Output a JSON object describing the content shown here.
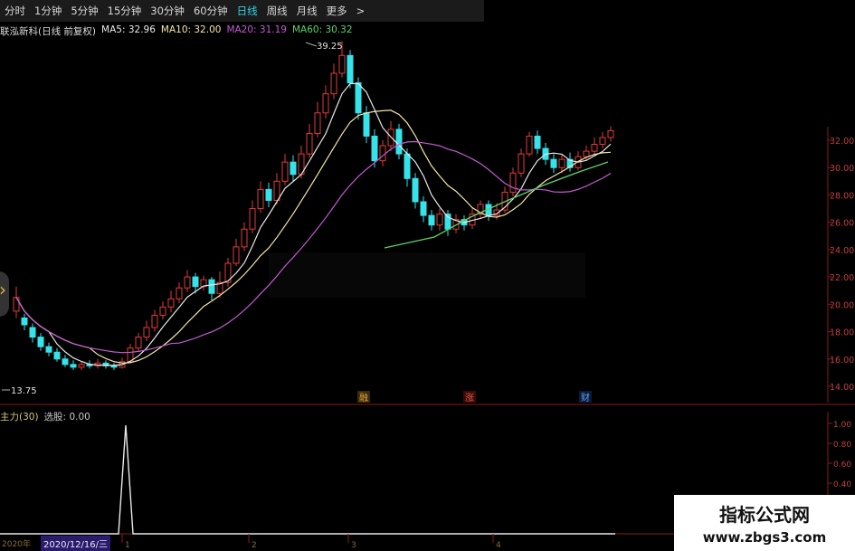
{
  "tabs": {
    "items": [
      "分时",
      "1分钟",
      "5分钟",
      "15分钟",
      "30分钟",
      "60分钟",
      "日线",
      "周线",
      "月线",
      "更多",
      ">"
    ],
    "active": "日线"
  },
  "info": {
    "stock_name": "联泓新科(日线 前复权)",
    "ma5": "MA5: 32.96",
    "ma10": "MA10: 32.00",
    "ma20": "MA20: 31.19",
    "ma60": "MA60: 30.32"
  },
  "annotations": {
    "high": "39.25",
    "low": "13.75",
    "event1": "融",
    "event2": "涨",
    "event3": "财"
  },
  "y_axis": [
    "32.00",
    "30.00",
    "28.00",
    "26.00",
    "24.00",
    "22.00",
    "20.00",
    "18.00",
    "16.00",
    "14.00"
  ],
  "lower_axis": [
    "1.00",
    "0.80",
    "0.60",
    "0.40",
    "0.20"
  ],
  "lower_panel": {
    "title": "主力(30)",
    "label": "选股: 0.00"
  },
  "x_axis": {
    "year": "2020年",
    "date_box": "2020/12/16/三",
    "months": [
      "1",
      "2",
      "3",
      "4"
    ]
  },
  "watermark": {
    "line1": "指标公式网",
    "line2": "www.zbgs3.com"
  },
  "colors": {
    "up": "#e23b3b",
    "down": "#35e3ea",
    "ma5": "#e8e8e8",
    "ma10": "#f4e6a6",
    "ma20": "#c45ad4",
    "ma60": "#59d36a",
    "grid": "#6b1515",
    "axis": "#8b1a1a"
  }
}
